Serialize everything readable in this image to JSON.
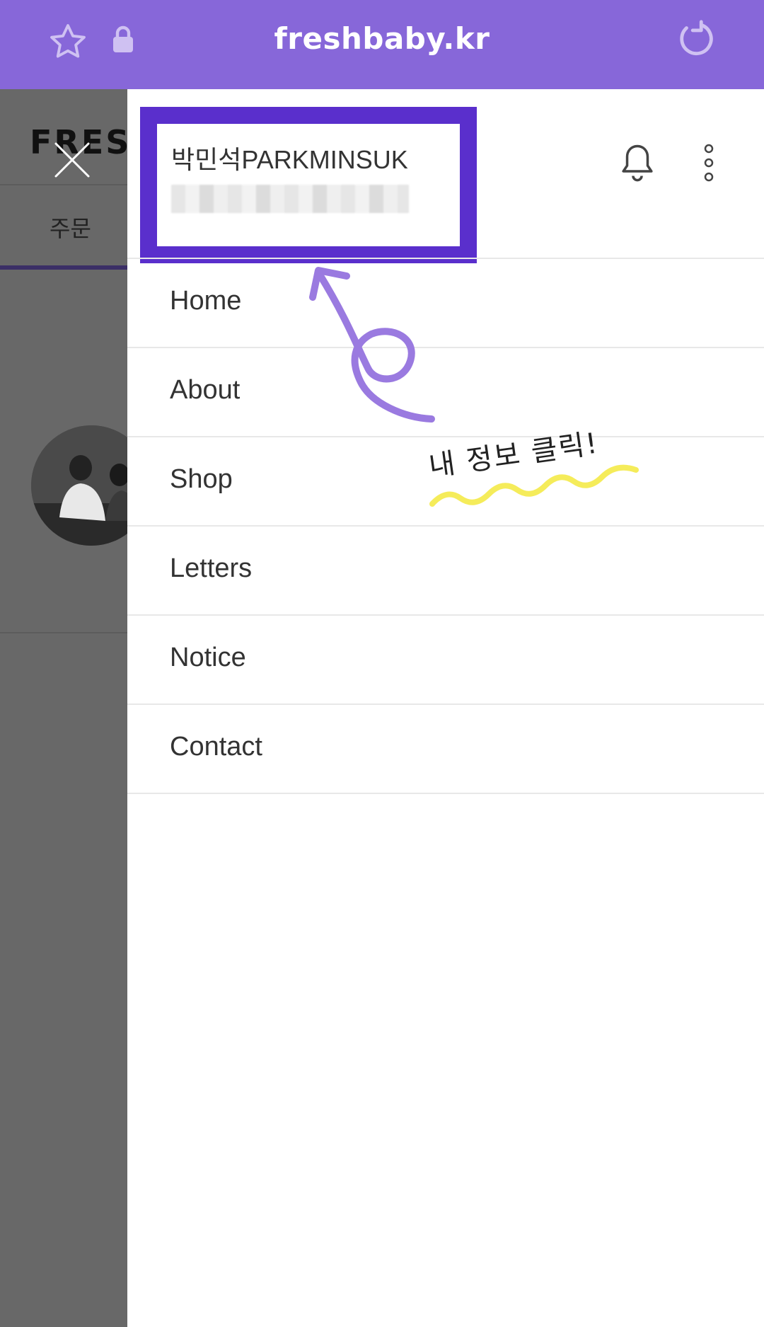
{
  "browser": {
    "url": "freshbaby.kr",
    "icons": [
      "star-icon",
      "lock-icon",
      "reload-icon"
    ],
    "accent": "#8767d9"
  },
  "background_page": {
    "brand": "FRESH",
    "tab_label": "주문"
  },
  "drawer": {
    "profile": {
      "name": "박민석PARKMINSUK",
      "highlight_color": "#5a2fcc"
    },
    "icons": [
      "bell-icon",
      "more-vertical-icon"
    ],
    "menu": [
      {
        "label": "Home"
      },
      {
        "label": "About"
      },
      {
        "label": "Shop"
      },
      {
        "label": "Letters"
      },
      {
        "label": "Notice"
      },
      {
        "label": "Contact"
      }
    ]
  },
  "annotation": {
    "text": "내 정보 클릭!",
    "arrow_color": "#9a7ae0",
    "underline_color": "#f5ec5a"
  }
}
